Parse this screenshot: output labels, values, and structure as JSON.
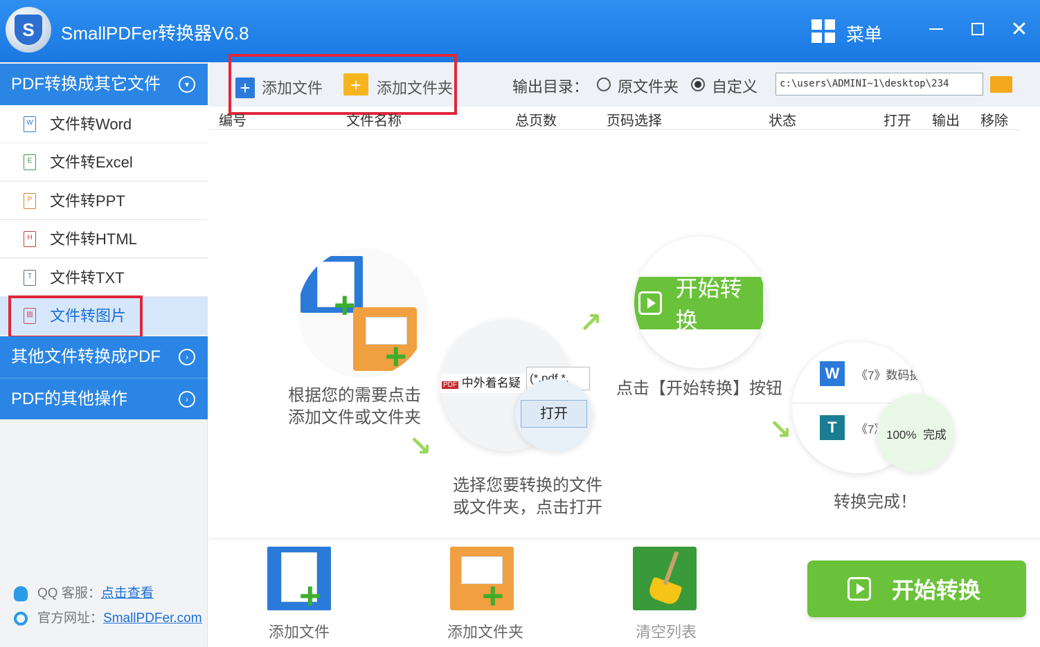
{
  "app": {
    "title": "SmallPDFer转换器V6.8",
    "logo_letter": "S",
    "menu_label": "菜单"
  },
  "sidebar": {
    "section1": "PDF转换成其它文件",
    "items": [
      {
        "label": "文件转Word",
        "icon": "W"
      },
      {
        "label": "文件转Excel",
        "icon": "E"
      },
      {
        "label": "文件转PPT",
        "icon": "P"
      },
      {
        "label": "文件转HTML",
        "icon": "H"
      },
      {
        "label": "文件转TXT",
        "icon": "T"
      },
      {
        "label": "文件转图片",
        "icon": "▨"
      }
    ],
    "section2": "其他文件转换成PDF",
    "section3": "PDF的其他操作",
    "support": {
      "qq_label": "QQ 客服：",
      "qq_link": "点击查看",
      "site_label": "官方网址：",
      "site_link": "SmallPDFer.com"
    }
  },
  "toolbar": {
    "add_file": "添加文件",
    "add_folder": "添加文件夹",
    "output_label": "输出目录：",
    "opt_original": "原文件夹",
    "opt_custom": "自定义",
    "output_path": "c:\\users\\ADMINI~1\\desktop\\234"
  },
  "table": {
    "columns": [
      "编号",
      "文件名称",
      "总页数",
      "页码选择",
      "状态",
      "打开",
      "输出",
      "移除"
    ]
  },
  "steps": {
    "step1": [
      "根据您的需要点击",
      "添加文件或文件夹"
    ],
    "step2": [
      "选择您要转换的文件",
      "或文件夹，点击打开"
    ],
    "step3": "点击【开始转换】按钮",
    "step4": "转换完成！",
    "demo_start": "开始转换",
    "demo_file": "中外着名疑",
    "demo_filter": "(*.pdf,*.",
    "demo_open": "打开",
    "demo_pdf_tag": "PDF",
    "demo_row1": "《7》数码摄",
    "demo_row2": "《7》",
    "demo_progress": "100%",
    "demo_done": "完成",
    "demo_w": "W",
    "demo_t": "T"
  },
  "bottom": {
    "add_file": "添加文件",
    "add_folder": "添加文件夹",
    "clear": "清空列表",
    "start": "开始转换"
  },
  "colors": {
    "titlebar": "#1a78e2",
    "sidebar_header": "#2b85e4",
    "highlight_box": "#e0263a",
    "start_green": "#6ac23a"
  }
}
